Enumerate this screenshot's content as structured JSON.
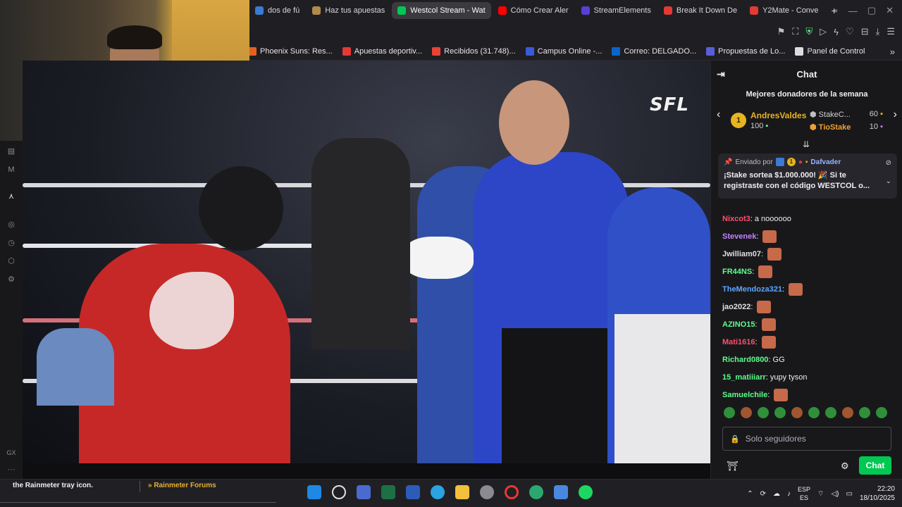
{
  "browser": {
    "tabs": [
      {
        "label": "dos de fú",
        "color": "#3a7bd5"
      },
      {
        "label": "Haz tus apuestas",
        "color": "#b08a4a"
      },
      {
        "label": "Westcol Stream - Wat",
        "color": "#00c853",
        "active": true
      },
      {
        "label": "Cómo Crear Aler",
        "color": "#ff0000"
      },
      {
        "label": "StreamElements",
        "color": "#5a3fd6"
      },
      {
        "label": "Break It Down De",
        "color": "#e53935"
      },
      {
        "label": "Y2Mate - Conve",
        "color": "#e53935"
      }
    ],
    "new_tab": "+",
    "bookmarks": [
      {
        "label": "Phoenix Suns: Res...",
        "color": "#e56020"
      },
      {
        "label": "Apuestas deportiv...",
        "color": "#e53935"
      },
      {
        "label": "Recibidos (31.748)...",
        "color": "#ea4335"
      },
      {
        "label": "Campus Online -...",
        "color": "#3a5bd5"
      },
      {
        "label": "Correo: DELGADO...",
        "color": "#0a64c8"
      },
      {
        "label": "Propuestas de Lo...",
        "color": "#5a5fd6"
      },
      {
        "label": "Panel de Control",
        "color": "#dddddd"
      }
    ]
  },
  "video": {
    "logo": "SFL"
  },
  "chat": {
    "header": "Chat",
    "donors_title": "Mejores donadores de la semana",
    "top_donor": {
      "rank": "1",
      "name": "AndresValdes",
      "amount": "100"
    },
    "donor2": {
      "name": "StakeC...",
      "amount": "60"
    },
    "donor3": {
      "name": "TioStake",
      "amount": "10"
    },
    "pinned": {
      "prefix": "Enviado por",
      "user": "Dafvader",
      "badge": "1",
      "message": "¡Stake sortea $1.000.000! 🎉 Si te registraste con el código WESTCOL o..."
    },
    "messages": [
      {
        "user": "Nixcot3",
        "color": "#ff4f6d",
        "text": ": a noooooo",
        "emote": false
      },
      {
        "user": "Stevenek",
        "color": "#c084fc",
        "text": ":",
        "emote": true
      },
      {
        "user": "Jwilliam07",
        "color": "#e0e0e0",
        "text": ":",
        "emote": true
      },
      {
        "user": "FR44NS",
        "color": "#5dff8a",
        "text": ":",
        "emote": true
      },
      {
        "user": "TheMendoza321",
        "color": "#5aa7ff",
        "text": ":",
        "emote": true
      },
      {
        "user": "jao2022",
        "color": "#e0e0e0",
        "text": ":",
        "emote": true
      },
      {
        "user": "AZINO15",
        "color": "#5dff8a",
        "text": ":",
        "emote": true
      },
      {
        "user": "Mati1616",
        "color": "#ff4f6d",
        "text": ":",
        "emote": true
      },
      {
        "user": "Richard0800",
        "color": "#5dff8a",
        "text": ": GG",
        "emote": false
      },
      {
        "user": "15_matiiiarr",
        "color": "#5dff8a",
        "text": ": yupy tyson",
        "emote": false
      },
      {
        "user": "Samuelchile",
        "color": "#5dff8a",
        "text": ":",
        "emote": true
      }
    ],
    "input_placeholder": "Solo seguidores",
    "send_label": "Chat"
  },
  "taskbar": {
    "left_text": "the Rainmeter tray icon.",
    "left_link": "» Rainmeter Forums",
    "lang_top": "ESP",
    "lang_bottom": "ES",
    "time": "22:20",
    "date": "18/10/2025"
  },
  "colors": {
    "accent": "#00c853",
    "gold": "#e6b422"
  }
}
